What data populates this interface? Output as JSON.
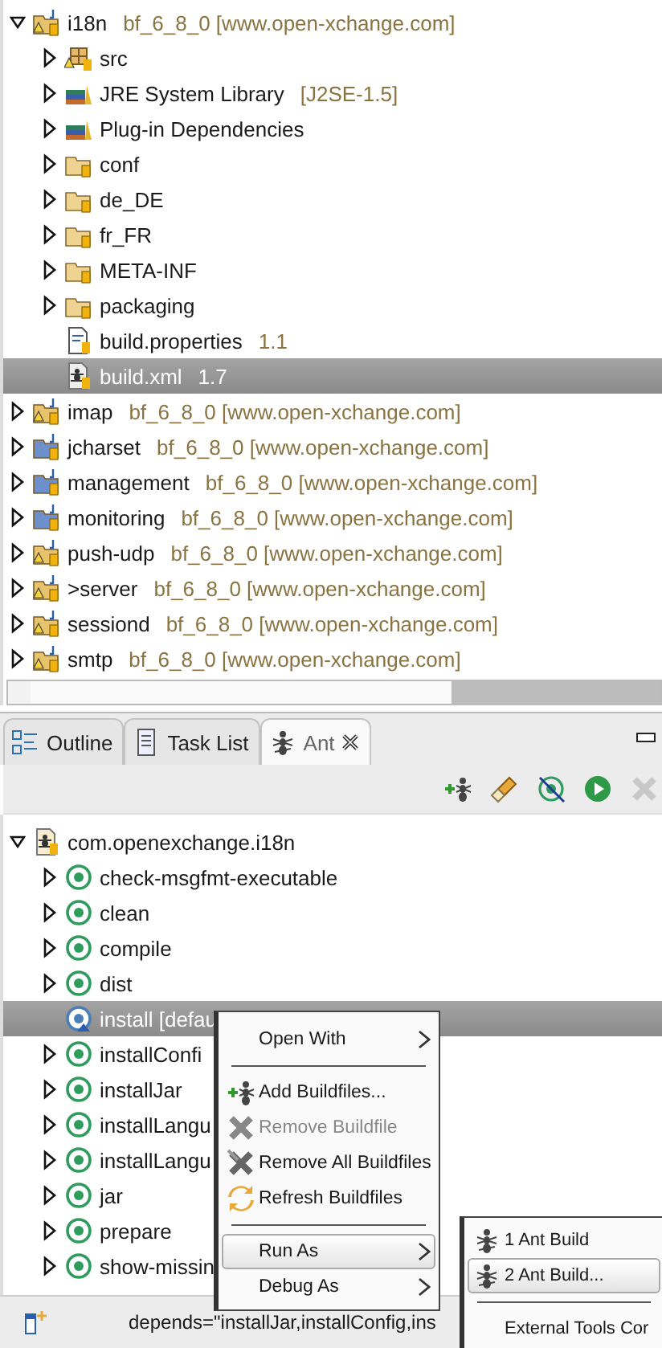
{
  "project_tree": [
    {
      "label": "i18n",
      "decoration": "bf_6_8_0 [www.open-xchange.com]",
      "kind": "project-warning",
      "expanded": true,
      "selected": false,
      "children": [
        {
          "label": "src",
          "kind": "package",
          "expanded": false,
          "selected": false
        },
        {
          "label": "JRE System Library",
          "decoration": "[J2SE-1.5]",
          "kind": "library",
          "expanded": false,
          "selected": false
        },
        {
          "label": "Plug-in Dependencies",
          "kind": "library",
          "expanded": false,
          "selected": false
        },
        {
          "label": "conf",
          "kind": "folder",
          "expanded": false,
          "selected": false
        },
        {
          "label": "de_DE",
          "kind": "folder",
          "expanded": false,
          "selected": false
        },
        {
          "label": "fr_FR",
          "kind": "folder",
          "expanded": false,
          "selected": false
        },
        {
          "label": "META-INF",
          "kind": "folder",
          "expanded": false,
          "selected": false
        },
        {
          "label": "packaging",
          "kind": "folder",
          "expanded": false,
          "selected": false
        },
        {
          "label": "build.properties",
          "decoration": "1.1",
          "kind": "properties",
          "selected": false
        },
        {
          "label": "build.xml",
          "decoration": "1.7",
          "kind": "xml",
          "selected": true
        }
      ]
    },
    {
      "label": "imap",
      "decoration": "bf_6_8_0 [www.open-xchange.com]",
      "kind": "project-warning",
      "expanded": false,
      "selected": false
    },
    {
      "label": "jcharset",
      "decoration": "bf_6_8_0 [www.open-xchange.com]",
      "kind": "project",
      "expanded": false,
      "selected": false
    },
    {
      "label": "management",
      "decoration": "bf_6_8_0 [www.open-xchange.com]",
      "kind": "project",
      "expanded": false,
      "selected": false
    },
    {
      "label": "monitoring",
      "decoration": "bf_6_8_0 [www.open-xchange.com]",
      "kind": "project",
      "expanded": false,
      "selected": false
    },
    {
      "label": "push-udp",
      "decoration": "bf_6_8_0 [www.open-xchange.com]",
      "kind": "project-warning",
      "expanded": false,
      "selected": false
    },
    {
      "label": ">server",
      "decoration": "bf_6_8_0 [www.open-xchange.com]",
      "kind": "project-warning",
      "expanded": false,
      "selected": false
    },
    {
      "label": "sessiond",
      "decoration": "bf_6_8_0 [www.open-xchange.com]",
      "kind": "project-warning",
      "expanded": false,
      "selected": false
    },
    {
      "label": "smtp",
      "decoration": "bf_6_8_0 [www.open-xchange.com]",
      "kind": "project-warning",
      "expanded": false,
      "selected": false
    }
  ],
  "tabs": [
    {
      "label": "Outline",
      "kind": "outline",
      "selected": false
    },
    {
      "label": "Task List",
      "kind": "tasks",
      "selected": false
    },
    {
      "label": "Ant",
      "kind": "ant",
      "selected": true
    }
  ],
  "ant_toolbar": [
    {
      "kind": "add-ant",
      "disabled": false
    },
    {
      "kind": "brush",
      "disabled": false
    },
    {
      "kind": "hide-target",
      "disabled": false
    },
    {
      "kind": "run",
      "disabled": false
    },
    {
      "kind": "remove",
      "disabled": true
    }
  ],
  "ant_tree": [
    {
      "label": "com.openexchange.i18n",
      "kind": "buildfile",
      "expanded": true,
      "selected": false,
      "children": [
        {
          "label": "check-msgfmt-executable",
          "kind": "target",
          "expanded": false,
          "selected": false
        },
        {
          "label": "clean",
          "kind": "target",
          "expanded": false,
          "selected": false
        },
        {
          "label": "compile",
          "kind": "target",
          "expanded": false,
          "selected": false
        },
        {
          "label": "dist",
          "kind": "target",
          "expanded": false,
          "selected": false
        },
        {
          "label": "install [defau",
          "kind": "target-default",
          "selected": true
        },
        {
          "label": "installConfi",
          "kind": "target",
          "expanded": false,
          "selected": false
        },
        {
          "label": "installJar",
          "kind": "target",
          "expanded": false,
          "selected": false
        },
        {
          "label": "installLangu",
          "kind": "target",
          "expanded": false,
          "selected": false
        },
        {
          "label": "installLangu",
          "kind": "target",
          "expanded": false,
          "selected": false
        },
        {
          "label": "jar",
          "kind": "target",
          "expanded": false,
          "selected": false
        },
        {
          "label": "prepare",
          "kind": "target",
          "expanded": false,
          "selected": false
        },
        {
          "label": "show-missin",
          "kind": "target",
          "expanded": false,
          "selected": false
        }
      ]
    }
  ],
  "context_menu": [
    {
      "kind": "submenu",
      "label": "Open With",
      "disabled": false,
      "selected": false
    },
    {
      "kind": "separator"
    },
    {
      "kind": "add",
      "label": "Add Buildfiles...",
      "disabled": false,
      "selected": false
    },
    {
      "kind": "remove",
      "label": "Remove Buildfile",
      "disabled": true,
      "selected": false
    },
    {
      "kind": "remove-all",
      "label": "Remove All Buildfiles",
      "disabled": false,
      "selected": false
    },
    {
      "kind": "refresh",
      "label": "Refresh Buildfiles",
      "disabled": false,
      "selected": false
    },
    {
      "kind": "separator"
    },
    {
      "kind": "submenu",
      "label": "Run As",
      "disabled": false,
      "selected": true
    },
    {
      "kind": "submenu",
      "label": "Debug As",
      "disabled": false,
      "selected": false
    }
  ],
  "submenu": [
    {
      "kind": "ant",
      "label": "1 Ant Build",
      "selected": false
    },
    {
      "kind": "ant",
      "label": "2 Ant Build...",
      "selected": true
    },
    {
      "kind": "separator"
    },
    {
      "kind": "plain",
      "label": "External Tools Cor",
      "selected": false
    }
  ],
  "status_bar": {
    "text": "depends=\"installJar,installConfig,ins"
  }
}
